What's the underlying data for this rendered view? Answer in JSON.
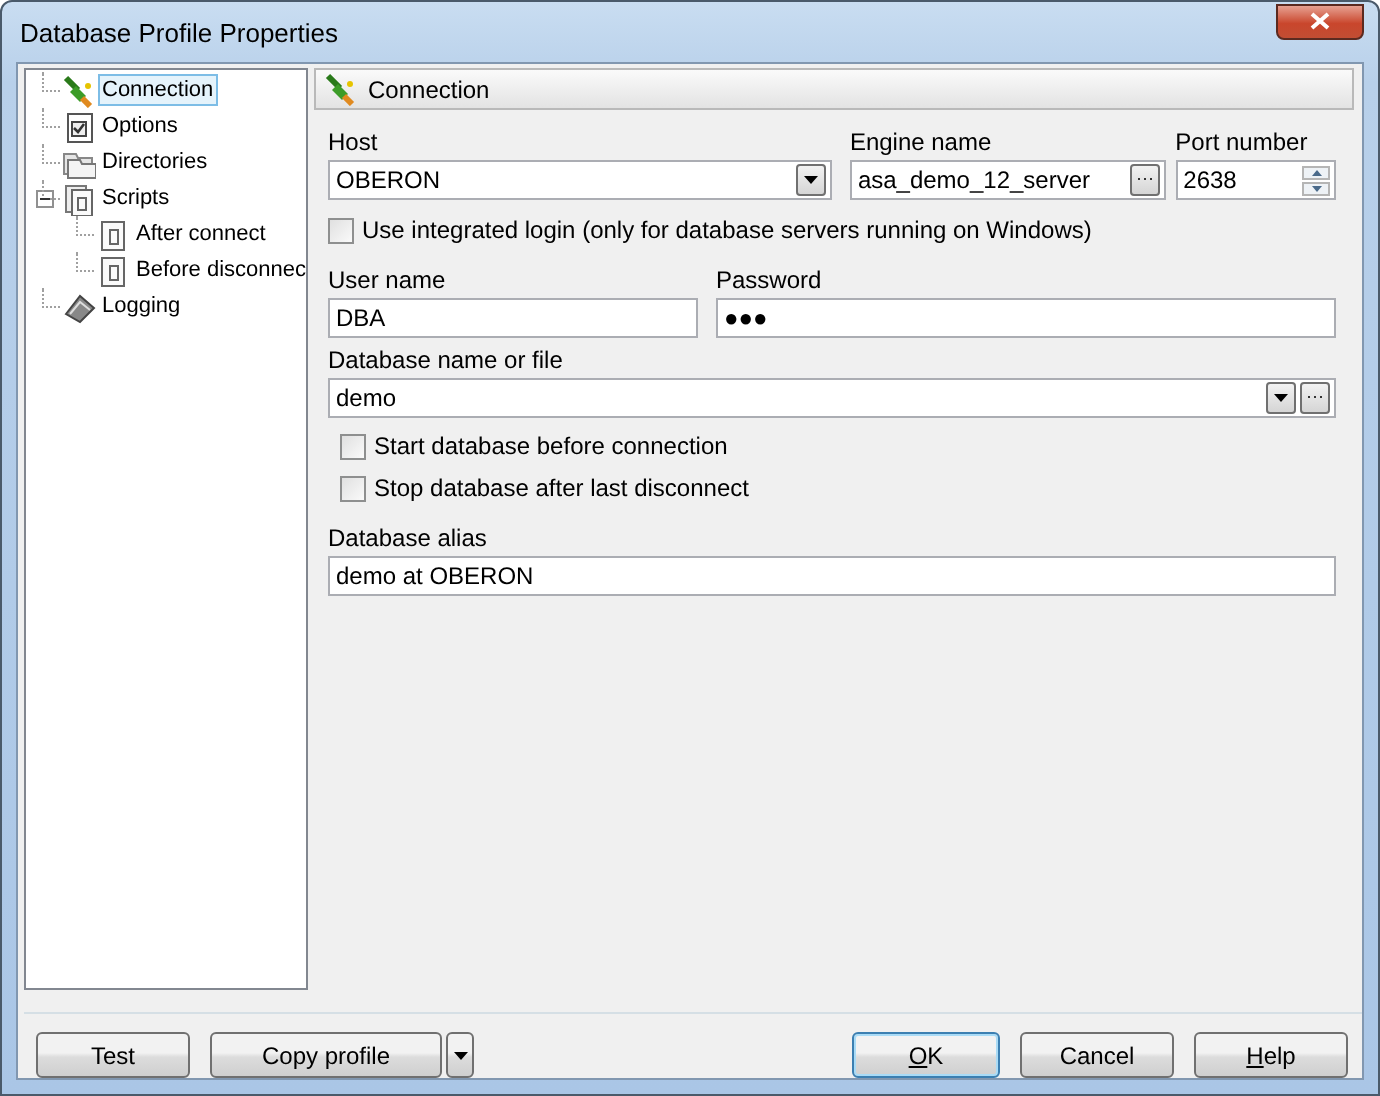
{
  "window": {
    "title": "Database Profile Properties"
  },
  "tree": [
    {
      "label": "Connection",
      "kind": "plug",
      "selected": true
    },
    {
      "label": "Options",
      "kind": "options",
      "selected": false
    },
    {
      "label": "Directories",
      "kind": "folders",
      "selected": false
    },
    {
      "label": "Scripts",
      "kind": "scripts",
      "selected": false,
      "expanded": true,
      "children": [
        {
          "label": "After connect",
          "kind": "script",
          "selected": false
        },
        {
          "label": "Before disconnec",
          "kind": "script",
          "selected": false
        }
      ]
    },
    {
      "label": "Logging",
      "kind": "log",
      "selected": false
    }
  ],
  "panel": {
    "title": "Connection"
  },
  "host": {
    "label": "Host",
    "value": "OBERON"
  },
  "engine": {
    "label": "Engine name",
    "value": "asa_demo_12_server"
  },
  "port": {
    "label": "Port number",
    "value": "2638"
  },
  "integrated_login": {
    "label": "Use integrated login (only for database servers running on Windows)",
    "checked": false
  },
  "user": {
    "label": "User name",
    "value": "DBA"
  },
  "password": {
    "label": "Password",
    "value": "●●●"
  },
  "database": {
    "label": "Database name or file",
    "value": "demo"
  },
  "start_db": {
    "label": "Start database before connection",
    "checked": false
  },
  "stop_db": {
    "label": "Stop database after last disconnect",
    "checked": false
  },
  "alias": {
    "label": "Database alias",
    "value": "demo at OBERON"
  },
  "buttons": [
    {
      "label": "Test",
      "kind": "plain",
      "access_key": false
    },
    {
      "label": "Copy profile",
      "kind": "split",
      "access_key": false
    },
    {
      "label": "OK",
      "kind": "default",
      "access_key": true
    },
    {
      "label": "Cancel",
      "kind": "plain",
      "access_key": false
    },
    {
      "label": "Help",
      "kind": "plain",
      "access_key": true
    }
  ]
}
